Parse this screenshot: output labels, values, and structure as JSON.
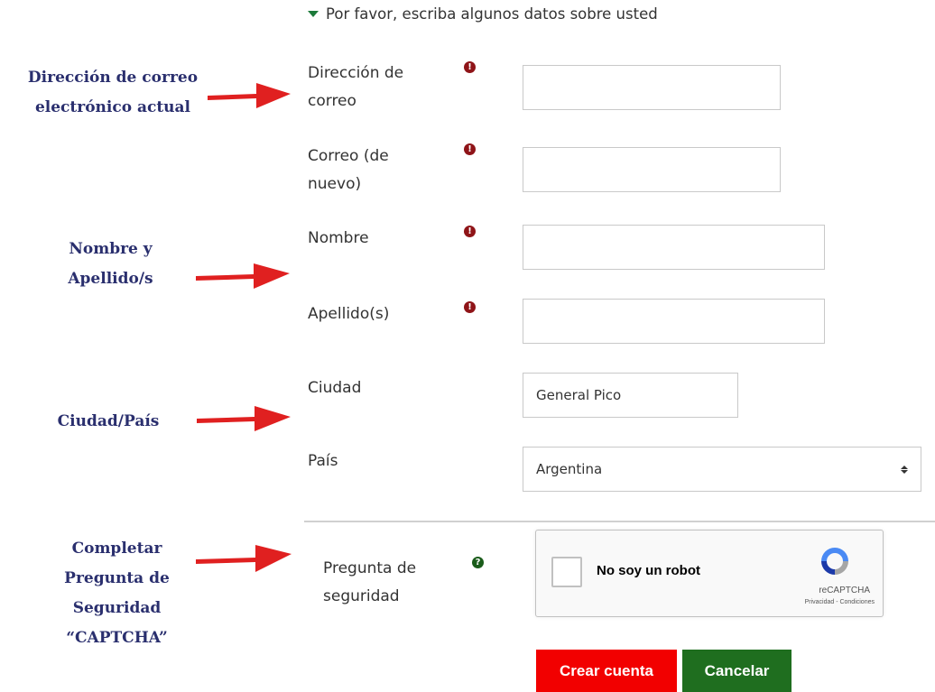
{
  "section": {
    "title": "Por favor, escriba algunos datos sobre usted"
  },
  "form": {
    "email_label": "Dirección de correo",
    "email_value": "",
    "email2_label": "Correo (de nuevo)",
    "email2_value": "",
    "firstname_label": "Nombre",
    "firstname_value": "",
    "lastname_label": "Apellido(s)",
    "lastname_value": "",
    "city_label": "Ciudad",
    "city_value": "General Pico",
    "country_label": "País",
    "country_value": "Argentina",
    "security_label": "Pregunta de seguridad",
    "required_glyph": "!",
    "help_glyph": "?"
  },
  "captcha": {
    "checkbox_label": "No soy un robot",
    "brand": "reCAPTCHA",
    "links": "Privacidad - Condiciones"
  },
  "buttons": {
    "create": "Crear cuenta",
    "cancel": "Cancelar"
  },
  "annotations": {
    "email": "Dirección de correo electrónico actual",
    "name": "Nombre y Apellido/s",
    "location": "Ciudad/País",
    "captcha": "Completar Pregunta de Seguridad “CAPTCHA”"
  },
  "colors": {
    "required": "#8f1418",
    "help": "#1a5c1a",
    "create_button": "#f20000",
    "cancel_button": "#1f6e1f",
    "annotation_text": "#2a2f6e",
    "arrow": "#e02020"
  }
}
